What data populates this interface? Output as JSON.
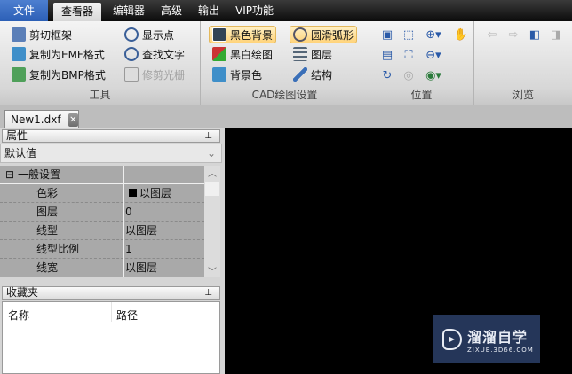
{
  "menu": {
    "tabs": [
      "文件",
      "查看器",
      "编辑器",
      "高级",
      "输出",
      "VIP功能"
    ],
    "active": "查看器"
  },
  "ribbon": {
    "tools": {
      "label": "工具",
      "items": [
        "剪切框架",
        "复制为EMF格式",
        "复制为BMP格式",
        "显示点",
        "查找文字",
        "修剪光栅"
      ]
    },
    "cad": {
      "label": "CAD绘图设置",
      "items": [
        "黑色背景",
        "黑白绘图",
        "背景色",
        "圆滑弧形",
        "图层",
        "结构"
      ]
    },
    "position": {
      "label": "位置"
    },
    "browse": {
      "label": "浏览"
    }
  },
  "doc_tab": {
    "name": "New1.dxf"
  },
  "properties": {
    "title": "属性",
    "selector": "默认值",
    "category": "一般设置",
    "rows": [
      {
        "name": "色彩",
        "value": "以图层"
      },
      {
        "name": "图层",
        "value": "0"
      },
      {
        "name": "线型",
        "value": "以图层"
      },
      {
        "name": "线型比例",
        "value": "1"
      },
      {
        "name": "线宽",
        "value": "以图层"
      }
    ]
  },
  "favorites": {
    "title": "收藏夹",
    "columns": [
      "名称",
      "路径"
    ]
  },
  "watermark": {
    "brand": "溜溜自学",
    "url": "ZIXUE.3D66.COM"
  },
  "colors": {
    "canvas": "#000000",
    "highlight": "#ffd37a",
    "file_tab": "#2c5fb6"
  }
}
